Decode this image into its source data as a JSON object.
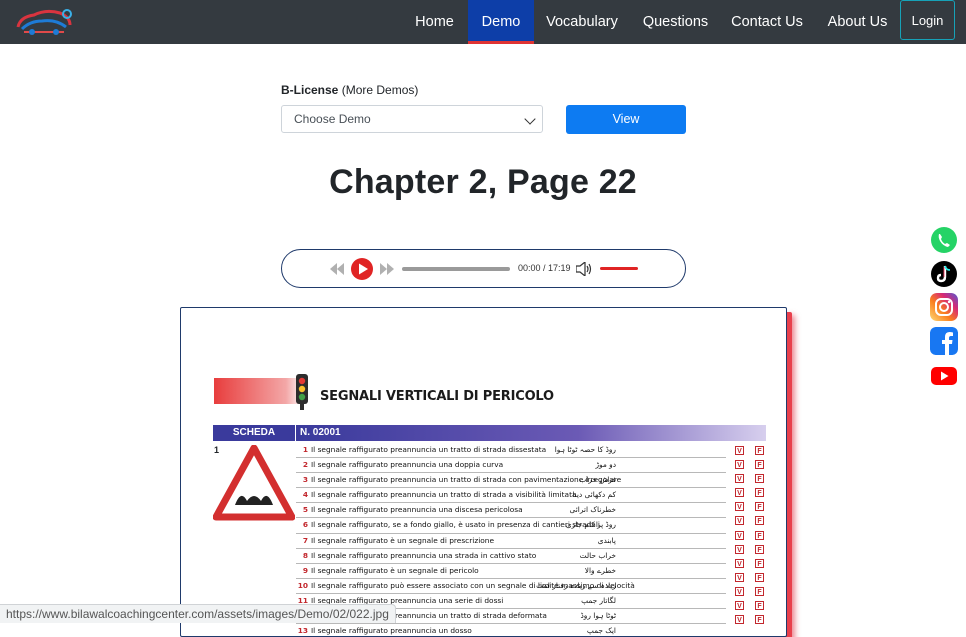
{
  "nav": {
    "logo_icon": "car-logo-icon",
    "items": [
      {
        "label": "Home"
      },
      {
        "label": "Demo",
        "active": true
      },
      {
        "label": "Vocabulary"
      },
      {
        "label": "Questions"
      },
      {
        "label": "Contact Us"
      },
      {
        "label": "About Us"
      }
    ],
    "login_label": "Login"
  },
  "demo": {
    "license_label": "B-License",
    "more_label": "(More Demos)",
    "select_value": "Choose Demo",
    "view_label": "View"
  },
  "page_title": "Chapter 2, Page 22",
  "player": {
    "current_time": "00:00",
    "duration": "17:19",
    "time_display": "00:00 / 17:19",
    "progress": 0,
    "volume": 1,
    "accent_color": "#e02424"
  },
  "scan": {
    "heading": "SEGNALI VERTICALI DI PERICOLO",
    "scheda_label": "SCHEDA",
    "scheda_number": "N. 02001",
    "sign_number": "1",
    "questions": [
      {
        "n": "1",
        "text": "Il segnale raffigurato preannuncia un tratto di strada dissestata",
        "urdu": "روڈ کا حصہ ٹوٹا ہوا"
      },
      {
        "n": "2",
        "text": "Il segnale raffigurato preannuncia una doppia curva",
        "urdu": "دو موڑ"
      },
      {
        "n": "3",
        "text": "Il segnale raffigurato preannuncia un tratto di strada con pavimentazione irregolare",
        "urdu": "فرش خراب"
      },
      {
        "n": "4",
        "text": "Il segnale raffigurato preannuncia un tratto di strada a visibilità limitata",
        "urdu": "کم دکھائی دینا"
      },
      {
        "n": "5",
        "text": "Il segnale raffigurato preannuncia una discesa pericolosa",
        "urdu": "خطرناک اترائی"
      },
      {
        "n": "6",
        "text": "Il segnale raffigurato, se a fondo giallo, è usato in presenza di cantieri stradali",
        "urdu": "روڈ پر کام جاری"
      },
      {
        "n": "7",
        "text": "Il segnale raffigurato è un segnale di prescrizione",
        "urdu": "پابندی"
      },
      {
        "n": "8",
        "text": "Il segnale raffigurato preannuncia una strada in cattivo stato",
        "urdu": "خراب حالت"
      },
      {
        "n": "9",
        "text": "Il segnale raffigurato è un segnale di pericolo",
        "urdu": "خطرے والا"
      },
      {
        "n": "10",
        "text": "Il segnale raffigurato può essere associato con un segnale di limite massimo di velocità",
        "urdu": "زیادہ سے زیادہ رفتار لمٹ"
      },
      {
        "n": "11",
        "text": "Il segnale raffigurato preannuncia una serie di dossi",
        "urdu": "لگاتار جمپ"
      },
      {
        "n": "12",
        "text": "Il segnale raffigurato preannuncia un tratto di strada deformata",
        "urdu": "ٹوٹا ہوا روڈ"
      },
      {
        "n": "13",
        "text": "Il segnale raffigurato preannuncia un dosso",
        "urdu": "ایک جمپ"
      }
    ],
    "true_mark": "V",
    "false_mark": "F"
  },
  "social": [
    {
      "icon": "whatsapp-icon",
      "color": "#25d366"
    },
    {
      "icon": "tiktok-icon",
      "color": "#000000"
    },
    {
      "icon": "instagram-icon",
      "color": "#d6249f"
    },
    {
      "icon": "facebook-icon",
      "color": "#1877f2"
    },
    {
      "icon": "youtube-icon",
      "color": "#ff0000"
    }
  ],
  "status_url": "https://www.bilawalcoachingcenter.com/assets/images/Demo/02/022.jpg",
  "colors": {
    "navbar_bg": "#343a40",
    "active_nav_bg": "#0d3ea8",
    "active_nav_underline": "#e03333",
    "view_button": "#0d7bf2"
  }
}
